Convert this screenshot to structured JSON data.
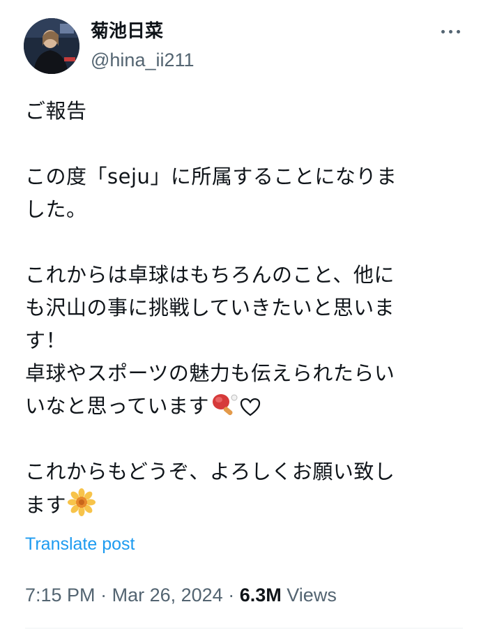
{
  "author": {
    "display_name": "菊池日菜",
    "handle": "@hina_ii211"
  },
  "more_icon": "more-horizontal-icon",
  "post": {
    "lines": [
      "ご報告",
      "",
      "この度「seju」に所属することになりま",
      "した。",
      "",
      "これからは卓球はもちろんのこと、他に",
      "も沢山の事に挑戦していきたいと思いま",
      "す！",
      "卓球やスポーツの魅力も伝えられたらい",
      "いなと思っています",
      "",
      "これからもどうぞ、よろしくお願い致し",
      "ます"
    ],
    "emojis": {
      "ping_pong": "ping-pong-paddle-emoji",
      "heart": "white-heart-emoji",
      "flower": "blossom-emoji"
    }
  },
  "translate_label": "Translate post",
  "meta": {
    "time": "7:15 PM",
    "separator": "·",
    "date": "Mar 26, 2024",
    "views_count": "6.3M",
    "views_label": "Views"
  },
  "colors": {
    "link": "#1d9bf0",
    "secondary_text": "#536471",
    "primary_text": "#0f1419"
  }
}
